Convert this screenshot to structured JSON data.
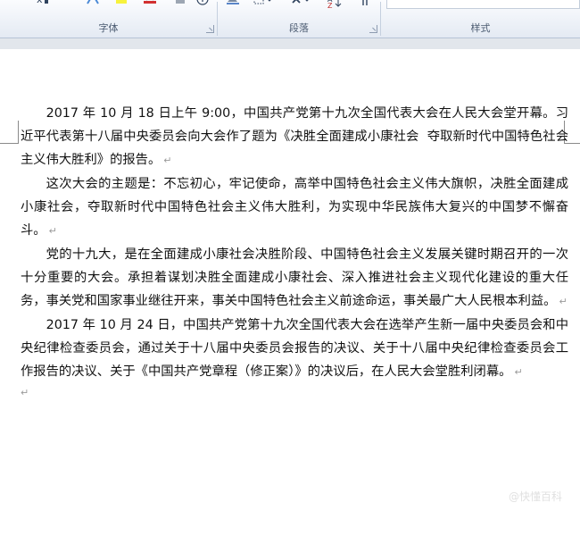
{
  "ribbon": {
    "groups": [
      {
        "label": "字体"
      },
      {
        "label": "段落"
      },
      {
        "label": "样式"
      }
    ]
  },
  "document": {
    "paragraphs": [
      "2017 年 10 月 18 日上午 9:00，中国共产党第十九次全国代表大会在人民大会堂开幕。习近平代表第十八届中央委员会向大会作了题为《决胜全面建成小康社会  夺取新时代中国特色社会主义伟大胜利》的报告。",
      "这次大会的主题是：不忘初心，牢记使命，高举中国特色社会主义伟大旗帜，决胜全面建成小康社会，夺取新时代中国特色社会主义伟大胜利，为实现中华民族伟大复兴的中国梦不懈奋斗。",
      "党的十九大，是在全面建成小康社会决胜阶段、中国特色社会主义发展关键时期召开的一次十分重要的大会。承担着谋划决胜全面建成小康社会、深入推进社会主义现代化建设的重大任务，事关党和国家事业继往开来，事关中国特色社会主义前途命运，事关最广大人民根本利益。",
      "2017 年 10 月 24 日，中国共产党第十九次全国代表大会在选举产生新一届中央委员会和中央纪律检查委员会，通过关于十八届中央委员会报告的决议、关于十八届中央纪律检查委员会工作报告的决议、关于《中国共产党章程（修正案）》的决议后，在人民大会堂胜利闭幕。"
    ],
    "paragraph_mark": "↵"
  },
  "watermark": {
    "text": "@快懂百科"
  }
}
